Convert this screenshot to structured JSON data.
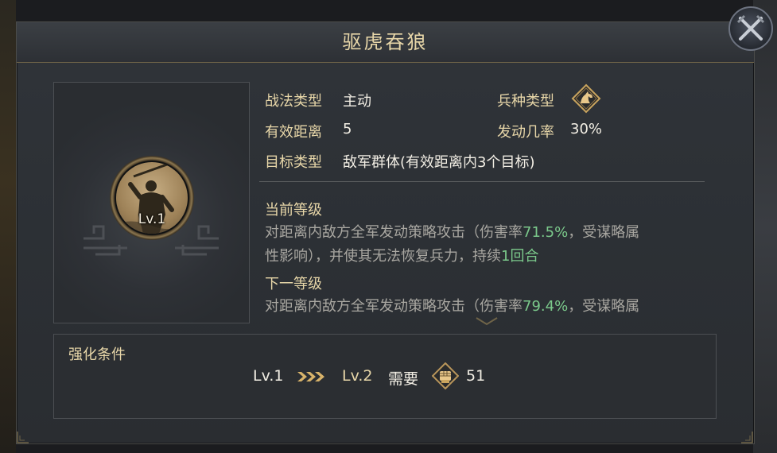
{
  "dialog": {
    "title": "驱虎吞狼"
  },
  "portrait": {
    "level": "Lv.1",
    "icon": "soldier-spear-portrait"
  },
  "info": {
    "tactic_type_label": "战法类型",
    "tactic_type_value": "主动",
    "troop_type_label": "兵种类型",
    "troop_type_icon": "cavalry-horse-icon",
    "range_label": "有效距离",
    "range_value": "5",
    "trigger_rate_label": "发动几率",
    "trigger_rate_value": "30%",
    "target_label": "目标类型",
    "target_value": "敌军群体(有效距离内3个目标)"
  },
  "current_level": {
    "heading": "当前等级",
    "line1_pre": "对距离内敌方全军发动策略攻击（伤害率",
    "line1_rate": "71.5%",
    "line1_post": "，受谋略属",
    "line2_pre": "性影响），并使其无法恢复兵力，持续",
    "line2_rounds": "1回合"
  },
  "next_level": {
    "heading": "下一等级",
    "line1_pre": "对距离内敌方全军发动策略攻击（伤害率",
    "line1_rate": "79.4%",
    "line1_post": "，受谋略属"
  },
  "upgrade": {
    "heading": "强化条件",
    "from_level": "Lv.1",
    "to_level": "Lv.2",
    "need_label": "需要",
    "cost": "51",
    "cost_icon": "fist-token-icon"
  },
  "colors": {
    "accent_gold": "#e7d6a8",
    "highlight_green": "#7bc98b",
    "desc_gray": "#a9a7a1",
    "panel_bg": "#2c3035"
  }
}
